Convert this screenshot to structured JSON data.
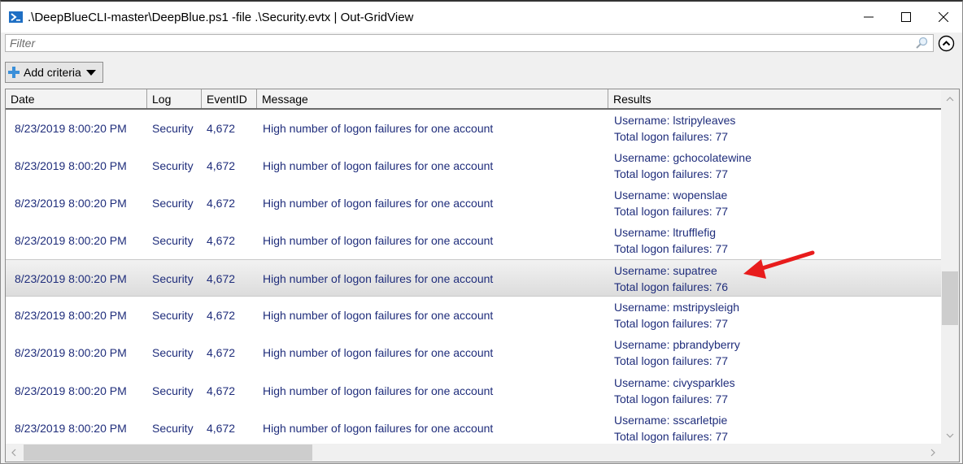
{
  "window": {
    "title": ".\\DeepBlueCLI-master\\DeepBlue.ps1 -file .\\Security.evtx | Out-GridView",
    "app_icon": "powershell-icon",
    "controls": {
      "minimize": "minimize-icon",
      "maximize": "maximize-icon",
      "close": "close-icon"
    }
  },
  "filter": {
    "placeholder": "Filter",
    "value": "",
    "search_icon": "search-icon",
    "collapse_icon": "chevron-up-circle-icon"
  },
  "toolbar": {
    "add_criteria_label": "Add criteria",
    "add_criteria_icon": "plus-icon",
    "dropdown_icon": "triangle-down-icon"
  },
  "grid": {
    "columns": [
      "Date",
      "Log",
      "EventID",
      "Message",
      "Results"
    ],
    "selected_row_index": 4,
    "rows": [
      {
        "date": "8/23/2019 8:00:20 PM",
        "log": "Security",
        "event_id": "4,672",
        "message": "High number of logon failures for one account",
        "results_line1": "Username: lstripyleaves",
        "results_line2": "Total logon failures: 77"
      },
      {
        "date": "8/23/2019 8:00:20 PM",
        "log": "Security",
        "event_id": "4,672",
        "message": "High number of logon failures for one account",
        "results_line1": "Username: gchocolatewine",
        "results_line2": "Total logon failures: 77"
      },
      {
        "date": "8/23/2019 8:00:20 PM",
        "log": "Security",
        "event_id": "4,672",
        "message": "High number of logon failures for one account",
        "results_line1": "Username: wopenslae",
        "results_line2": "Total logon failures: 77"
      },
      {
        "date": "8/23/2019 8:00:20 PM",
        "log": "Security",
        "event_id": "4,672",
        "message": "High number of logon failures for one account",
        "results_line1": "Username: ltrufflefig",
        "results_line2": "Total logon failures: 77"
      },
      {
        "date": "8/23/2019 8:00:20 PM",
        "log": "Security",
        "event_id": "4,672",
        "message": "High number of logon failures for one account",
        "results_line1": "Username: supatree",
        "results_line2": "Total logon failures: 76"
      },
      {
        "date": "8/23/2019 8:00:20 PM",
        "log": "Security",
        "event_id": "4,672",
        "message": "High number of logon failures for one account",
        "results_line1": "Username: mstripysleigh",
        "results_line2": "Total logon failures: 77"
      },
      {
        "date": "8/23/2019 8:00:20 PM",
        "log": "Security",
        "event_id": "4,672",
        "message": "High number of logon failures for one account",
        "results_line1": "Username: pbrandyberry",
        "results_line2": "Total logon failures: 77"
      },
      {
        "date": "8/23/2019 8:00:20 PM",
        "log": "Security",
        "event_id": "4,672",
        "message": "High number of logon failures for one account",
        "results_line1": "Username: civysparkles",
        "results_line2": "Total logon failures: 77"
      },
      {
        "date": "8/23/2019 8:00:20 PM",
        "log": "Security",
        "event_id": "4,672",
        "message": "High number of logon failures for one account",
        "results_line1": "Username: sscarletpie",
        "results_line2": "Total logon failures: 77"
      }
    ]
  },
  "annotation": {
    "type": "red-arrow",
    "points_to": "Username: supatree",
    "color": "#e81c1c"
  },
  "colors": {
    "row_text": "#1f2d7b",
    "selection": "#e3e3e3",
    "accent": "#1f6fc4"
  }
}
